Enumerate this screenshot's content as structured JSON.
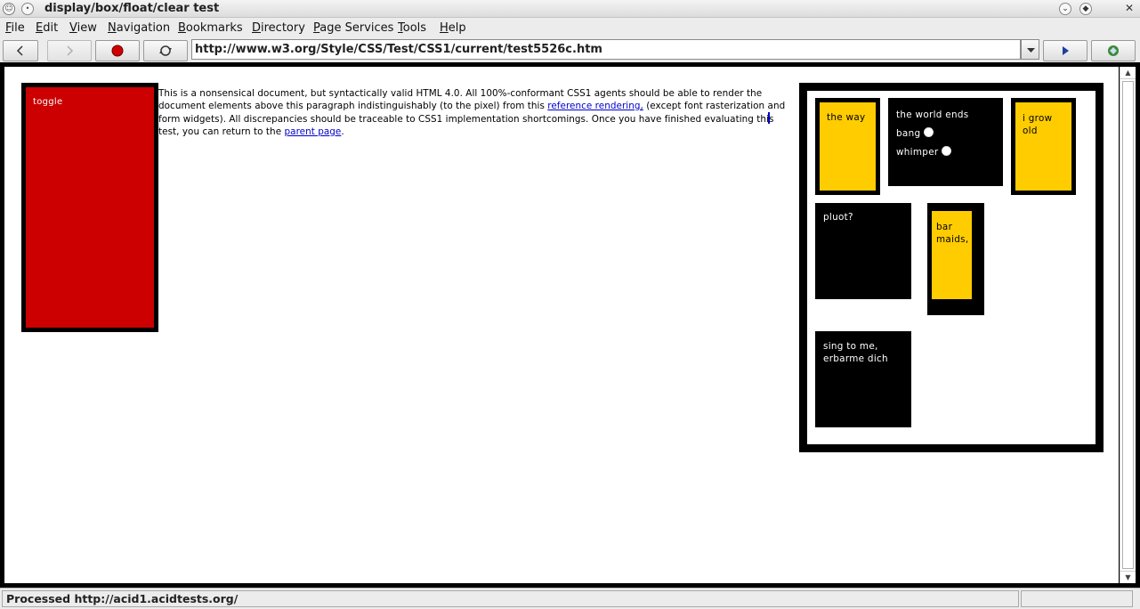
{
  "window": {
    "title": "display/box/float/clear test"
  },
  "menu": [
    {
      "pre": "",
      "acc": "F",
      "post": "ile"
    },
    {
      "pre": "",
      "acc": "E",
      "post": "dit"
    },
    {
      "pre": "",
      "acc": "V",
      "post": "iew"
    },
    {
      "pre": "",
      "acc": "N",
      "post": "avigation"
    },
    {
      "pre": "",
      "acc": "B",
      "post": "ookmarks"
    },
    {
      "pre": "",
      "acc": "D",
      "post": "irectory"
    },
    {
      "pre": "",
      "acc": "P",
      "post": "age Services"
    },
    {
      "pre": "",
      "acc": "T",
      "post": "ools"
    },
    {
      "pre": "",
      "acc": "H",
      "post": "elp"
    }
  ],
  "toolbar": {
    "url": "http://www.w3.org/Style/CSS/Test/CSS1/current/test5526c.htm",
    "icons": [
      "back-icon",
      "forward-icon",
      "stop-icon",
      "reload-icon",
      "go-icon",
      "throbber-icon"
    ]
  },
  "page": {
    "toggle_label": "toggle",
    "paragraph": {
      "part1": "This is a nonsensical document, but syntactically valid HTML 4.0. All 100%-conformant CSS1 agents should be able to render the document elements above this paragraph indistinguishably (to the pixel) from this ",
      "link1": "reference rendering,",
      "part2": " (except font rasterization and form widgets). All discrepancies should be traceable to CSS1 implementation shortcomings. Once you have finished evaluating thi",
      "part3": "s test, you can return to the ",
      "link2": "parent page",
      "part4": "."
    },
    "acid": {
      "the_way": "the way",
      "world_ends": "the world ends",
      "bang": "bang",
      "whimper": "whimper",
      "grow_old": "i grow old",
      "pluot": "pluot?",
      "bar_maids": "bar maids,",
      "sing": "sing to me, erbarme dich"
    }
  },
  "status": {
    "text": "Processed http://acid1.acidtests.org/"
  },
  "colors": {
    "red": "#cc0000",
    "gold": "#ffcc00",
    "link": "#0000cc"
  }
}
